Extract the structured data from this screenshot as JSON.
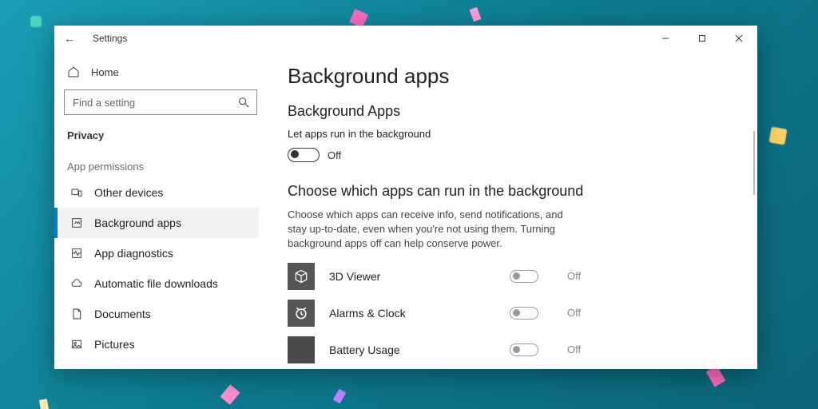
{
  "window": {
    "title": "Settings"
  },
  "sidebar": {
    "home": "Home",
    "search_placeholder": "Find a setting",
    "current_section": "Privacy",
    "group_label": "App permissions",
    "items": [
      {
        "label": "Other devices"
      },
      {
        "label": "Background apps"
      },
      {
        "label": "App diagnostics"
      },
      {
        "label": "Automatic file downloads"
      },
      {
        "label": "Documents"
      },
      {
        "label": "Pictures"
      }
    ]
  },
  "main": {
    "heading": "Background apps",
    "subheading": "Background Apps",
    "master_hint": "Let apps run in the background",
    "master_state": "Off",
    "choose_heading": "Choose which apps can run in the background",
    "choose_desc": "Choose which apps can receive info, send notifications, and stay up-to-date, even when you're not using them. Turning background apps off can help conserve power.",
    "apps": [
      {
        "name": "3D Viewer",
        "state": "Off"
      },
      {
        "name": "Alarms & Clock",
        "state": "Off"
      },
      {
        "name": "Battery Usage",
        "state": "Off"
      }
    ]
  }
}
